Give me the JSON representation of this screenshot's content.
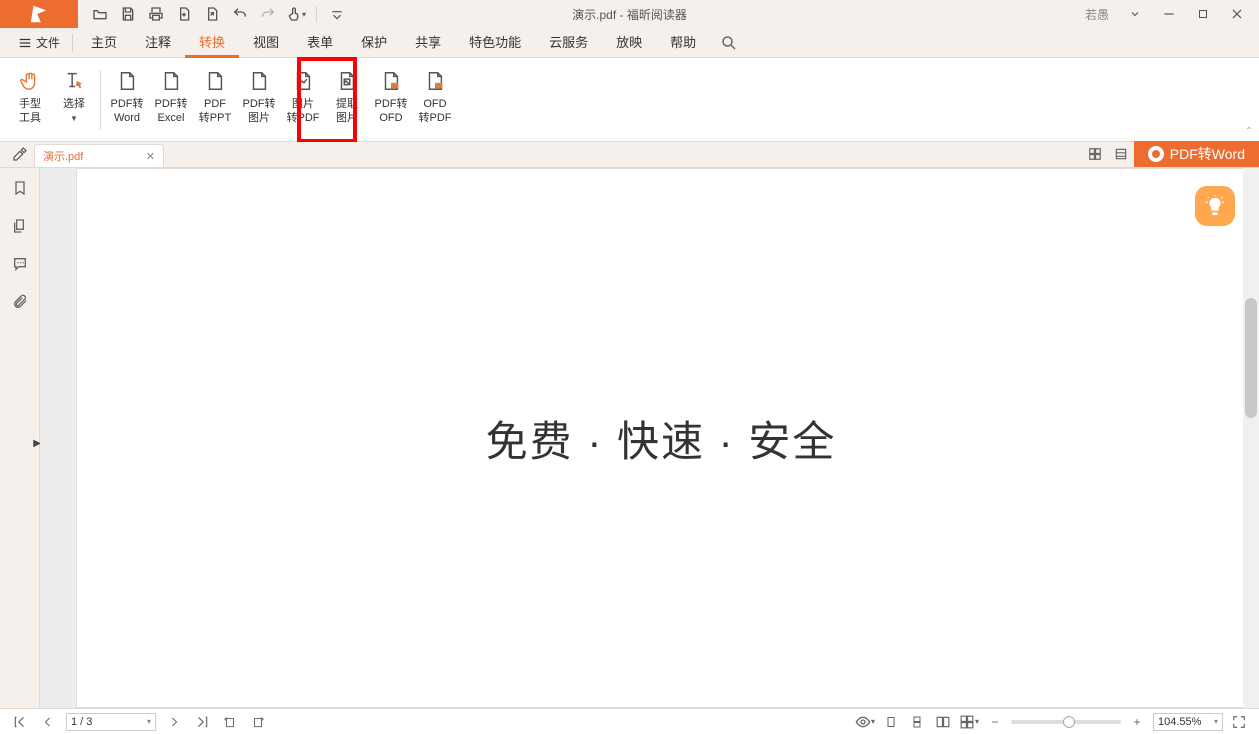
{
  "title": {
    "doc": "演示.pdf",
    "app": "福昕阅读器",
    "sep": " - "
  },
  "user_label": "若愚",
  "menu": {
    "file": "文件",
    "items": [
      "主页",
      "注释",
      "转换",
      "视图",
      "表单",
      "保护",
      "共享",
      "特色功能",
      "云服务",
      "放映",
      "帮助"
    ],
    "active_index": 2
  },
  "ribbon": {
    "hand": {
      "l1": "手型",
      "l2": "工具"
    },
    "select": {
      "l1": "选择",
      "l2": ""
    },
    "items": [
      {
        "l1": "PDF转",
        "l2": "Word"
      },
      {
        "l1": "PDF转",
        "l2": "Excel"
      },
      {
        "l1": "PDF",
        "l2": "转PPT"
      },
      {
        "l1": "PDF转",
        "l2": "图片"
      },
      {
        "l1": "图片",
        "l2": "转PDF"
      },
      {
        "l1": "提取",
        "l2": "图片"
      },
      {
        "l1": "PDF转",
        "l2": "OFD"
      },
      {
        "l1": "OFD",
        "l2": "转PDF"
      }
    ],
    "highlight_index": 5
  },
  "tab": {
    "name": "演示.pdf"
  },
  "pdf2word_button": "PDF转Word",
  "page_content": "免费 · 快速 · 安全",
  "status": {
    "page": "1 / 3",
    "zoom": "104.55%"
  }
}
